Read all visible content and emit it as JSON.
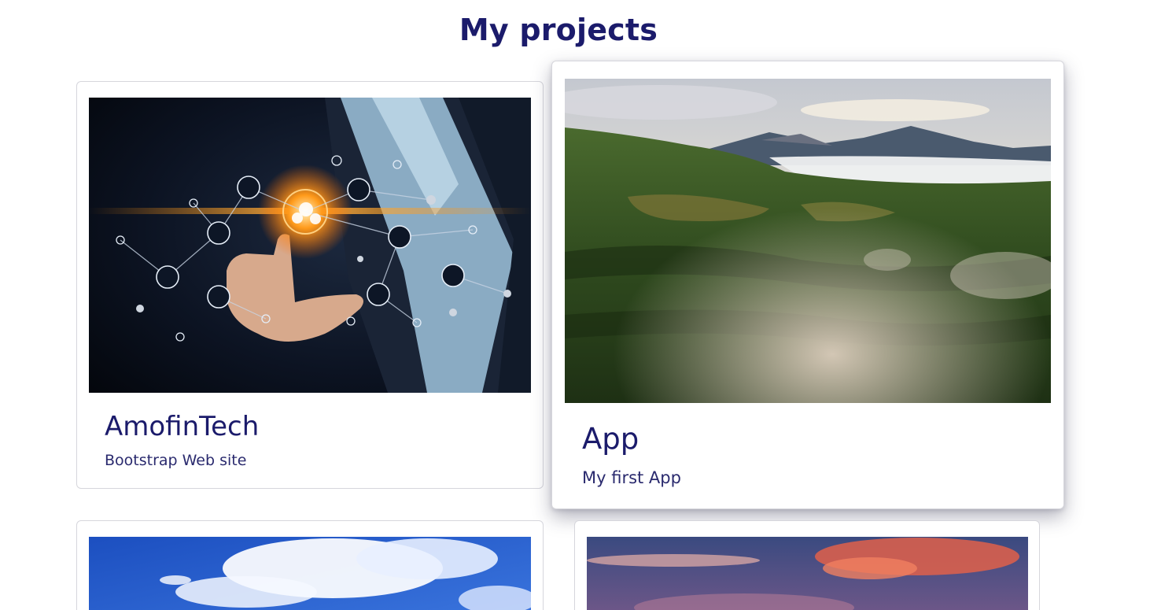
{
  "heading": "My projects",
  "projects": [
    {
      "title": "AmofinTech",
      "description": "Bootstrap Web site",
      "image_icon": "tech-network-image"
    },
    {
      "title": "App",
      "description": "My first App",
      "image_icon": "mountain-forest-image"
    },
    {
      "title": "",
      "description": "",
      "image_icon": "blue-sky-clouds-image"
    },
    {
      "title": "",
      "description": "",
      "image_icon": "sunset-sky-image"
    }
  ],
  "colors": {
    "heading": "#1b1b6b",
    "text": "#2a2a6e",
    "border": "#d6d6dc"
  }
}
